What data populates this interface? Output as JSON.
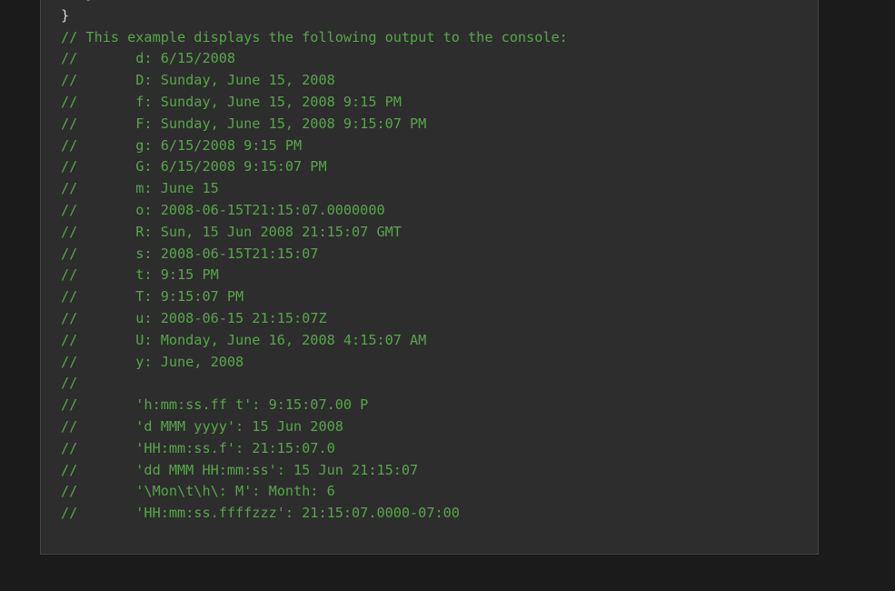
{
  "code": {
    "lines": [
      {
        "kind": "plain",
        "text": "   }"
      },
      {
        "kind": "plain",
        "text": "}"
      },
      {
        "kind": "comment",
        "text": "// This example displays the following output to the console:"
      },
      {
        "kind": "comment",
        "text": "//       d: 6/15/2008"
      },
      {
        "kind": "comment",
        "text": "//       D: Sunday, June 15, 2008"
      },
      {
        "kind": "comment",
        "text": "//       f: Sunday, June 15, 2008 9:15 PM"
      },
      {
        "kind": "comment",
        "text": "//       F: Sunday, June 15, 2008 9:15:07 PM"
      },
      {
        "kind": "comment",
        "text": "//       g: 6/15/2008 9:15 PM"
      },
      {
        "kind": "comment",
        "text": "//       G: 6/15/2008 9:15:07 PM"
      },
      {
        "kind": "comment",
        "text": "//       m: June 15"
      },
      {
        "kind": "comment",
        "text": "//       o: 2008-06-15T21:15:07.0000000"
      },
      {
        "kind": "comment",
        "text": "//       R: Sun, 15 Jun 2008 21:15:07 GMT"
      },
      {
        "kind": "comment",
        "text": "//       s: 2008-06-15T21:15:07"
      },
      {
        "kind": "comment",
        "text": "//       t: 9:15 PM"
      },
      {
        "kind": "comment",
        "text": "//       T: 9:15:07 PM"
      },
      {
        "kind": "comment",
        "text": "//       u: 2008-06-15 21:15:07Z"
      },
      {
        "kind": "comment",
        "text": "//       U: Monday, June 16, 2008 4:15:07 AM"
      },
      {
        "kind": "comment",
        "text": "//       y: June, 2008"
      },
      {
        "kind": "comment",
        "text": "//"
      },
      {
        "kind": "comment",
        "text": "//       'h:mm:ss.ff t': 9:15:07.00 P"
      },
      {
        "kind": "comment",
        "text": "//       'd MMM yyyy': 15 Jun 2008"
      },
      {
        "kind": "comment",
        "text": "//       'HH:mm:ss.f': 21:15:07.0"
      },
      {
        "kind": "comment",
        "text": "//       'dd MMM HH:mm:ss': 15 Jun 21:15:07"
      },
      {
        "kind": "comment",
        "text": "//       '\\Mon\\t\\h\\: M': Month: 6"
      },
      {
        "kind": "comment",
        "text": "//       'HH:mm:ss.ffffzzz': 21:15:07.0000-07:00"
      }
    ]
  },
  "colors": {
    "comment": "#57a64a",
    "plain": "#d4d4d4",
    "panel_background": "#2d2d2d",
    "page_background": "#1b1b1b"
  }
}
